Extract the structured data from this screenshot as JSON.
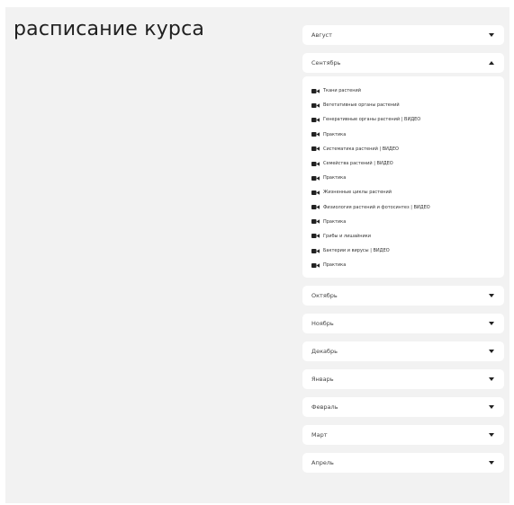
{
  "title": "расписание курса",
  "months": {
    "august": {
      "label": "Август",
      "state": "collapsed"
    },
    "september": {
      "label": "Сентябрь",
      "state": "expanded",
      "lessons": [
        "Ткани растений",
        "Вегетативные органы растений",
        "Генеративные органы растений | ВИДЕО",
        "Практика",
        "Систематика растений | ВИДЕО",
        "Семейства растений | ВИДЕО",
        "Практика",
        "Жизненные циклы растений",
        "Физиология растений и фотосинтез | ВИДЕО",
        "Практика",
        "Грибы и лишайники",
        "Бактерии и вирусы | ВИДЕО",
        "Практика"
      ]
    },
    "october": {
      "label": "Октябрь",
      "state": "collapsed"
    },
    "november": {
      "label": "Ноябрь",
      "state": "collapsed"
    },
    "december": {
      "label": "Декабрь",
      "state": "collapsed"
    },
    "january": {
      "label": "Январь",
      "state": "collapsed"
    },
    "february": {
      "label": "Февраль",
      "state": "collapsed"
    },
    "march": {
      "label": "Март",
      "state": "collapsed"
    },
    "april": {
      "label": "Апрель",
      "state": "collapsed"
    }
  },
  "icons": {
    "lesson": "video-camera-icon",
    "collapsed": "chevron-down-icon",
    "expanded": "chevron-up-icon"
  },
  "colors": {
    "background": "#f2f2f2",
    "card": "#ffffff",
    "text": "#1f1f1f"
  }
}
